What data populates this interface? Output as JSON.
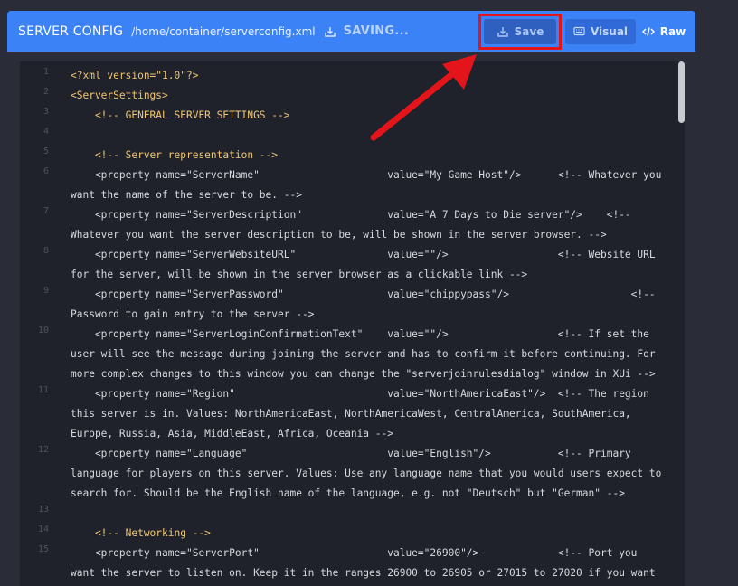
{
  "header": {
    "title": "SERVER CONFIG",
    "path": "/home/container/serverconfig.xml",
    "status": "SAVING...",
    "save_label": "Save",
    "visual_label": "Visual",
    "raw_label": "Raw"
  },
  "editor": {
    "line_numbers": [
      "1",
      "2",
      "3",
      "4",
      "5",
      "6",
      "7",
      "8",
      "9",
      "10",
      "11",
      "12",
      "13",
      "14",
      "15"
    ],
    "rows": [
      "<?xml version=\"1.0\"?>",
      "<ServerSettings>",
      "    <!-- GENERAL SERVER SETTINGS -->",
      "",
      "    <!-- Server representation -->",
      "    <property name=\"ServerName\"                     value=\"My Game Host\"/>      <!-- Whatever you",
      "want the name of the server to be. -->",
      "    <property name=\"ServerDescription\"              value=\"A 7 Days to Die server\"/>    <!--",
      "Whatever you want the server description to be, will be shown in the server browser. -->",
      "    <property name=\"ServerWebsiteURL\"               value=\"\"/>                  <!-- Website URL",
      "for the server, will be shown in the server browser as a clickable link -->",
      "    <property name=\"ServerPassword\"                 value=\"chippypass\"/>                    <!--",
      "Password to gain entry to the server -->",
      "    <property name=\"ServerLoginConfirmationText\"    value=\"\"/>                  <!-- If set the",
      "user will see the message during joining the server and has to confirm it before continuing. For",
      "more complex changes to this window you can change the \"serverjoinrulesdialog\" window in XUi -->",
      "    <property name=\"Region\"                         value=\"NorthAmericaEast\"/>  <!-- The region",
      "this server is in. Values: NorthAmericaEast, NorthAmericaWest, CentralAmerica, SouthAmerica,",
      "Europe, Russia, Asia, MiddleEast, Africa, Oceania -->",
      "    <property name=\"Language\"                       value=\"English\"/>           <!-- Primary",
      "language for players on this server. Values: Use any language name that you would users expect to",
      "search for. Should be the English name of the language, e.g. not \"Deutsch\" but \"German\" -->",
      "",
      "    <!-- Networking -->",
      "    <property name=\"ServerPort\"                     value=\"26900\"/>             <!-- Port you",
      "want the server to listen on. Keep it in the ranges 26900 to 26905 or 27015 to 27020 if you want"
    ]
  },
  "colors": {
    "header_bg": "#3b82f6",
    "editor_bg": "#1f222a",
    "highlight": "#e3151a"
  }
}
